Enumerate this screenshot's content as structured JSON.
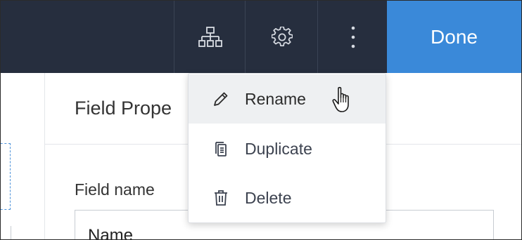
{
  "toolbar": {
    "icons": [
      "hierarchy-icon",
      "gear-icon",
      "more-vertical-icon"
    ],
    "done_label": "Done",
    "colors": {
      "bar": "#262e3e",
      "done": "#3a89d9"
    }
  },
  "properties": {
    "title": "Field Prope",
    "field_name_label": "Field name",
    "field_name_value": "Name"
  },
  "menu": {
    "items": [
      {
        "label": "Rename",
        "icon": "pencil-icon",
        "hovered": true
      },
      {
        "label": "Duplicate",
        "icon": "duplicate-icon",
        "hovered": false
      },
      {
        "label": "Delete",
        "icon": "trash-icon",
        "hovered": false
      }
    ]
  }
}
